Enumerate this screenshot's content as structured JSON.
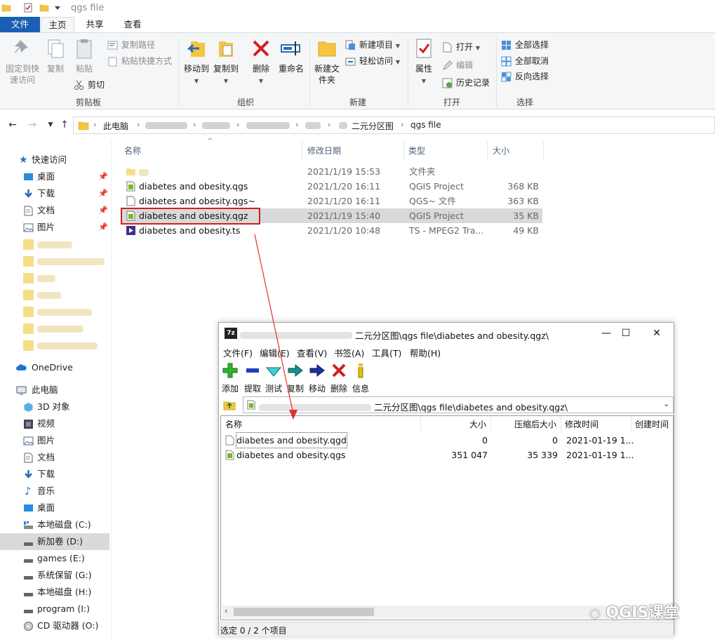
{
  "window": {
    "title": "qgs file"
  },
  "ribbon_tabs": [
    "文件",
    "主页",
    "共享",
    "查看"
  ],
  "ribbon": {
    "clipboard": {
      "label": "剪贴板",
      "pin_quick_access": "固定到快速访问",
      "copy": "复制",
      "paste": "粘贴",
      "copy_path": "复制路径",
      "paste_shortcut": "粘贴快捷方式",
      "cut": "剪切"
    },
    "organize": {
      "label": "组织",
      "move_to": "移动到",
      "copy_to": "复制到",
      "delete": "删除",
      "rename": "重命名"
    },
    "new": {
      "label": "新建",
      "new_folder": "新建文件夹",
      "new_item": "新建项目",
      "easy_access": "轻松访问"
    },
    "open": {
      "label": "打开",
      "properties": "属性",
      "open": "打开",
      "edit": "编辑",
      "history": "历史记录"
    },
    "select": {
      "label": "选择",
      "select_all": "全部选择",
      "select_none": "全部取消",
      "invert": "反向选择"
    }
  },
  "address": {
    "this_pc": "此电脑",
    "folder": "二元分区图",
    "current": "qgs file"
  },
  "nav": {
    "quick_access": "快速访问",
    "desktop": "桌面",
    "downloads": "下载",
    "documents": "文档",
    "pictures": "图片",
    "onedrive": "OneDrive",
    "this_pc": "此电脑",
    "objects3d": "3D 对象",
    "videos": "视频",
    "pictures2": "图片",
    "documents2": "文档",
    "downloads2": "下载",
    "music": "音乐",
    "desktop2": "桌面",
    "drive_c": "本地磁盘 (C:)",
    "drive_d": "新加卷 (D:)",
    "drive_e": "games (E:)",
    "drive_g": "系统保留 (G:)",
    "drive_h": "本地磁盘 (H:)",
    "drive_i": "program (I:)",
    "drive_o": "CD 驱动器 (O:)"
  },
  "filelist": {
    "headers": {
      "name": "名称",
      "modified": "修改日期",
      "type": "类型",
      "size": "大小"
    },
    "rows": [
      {
        "name": "",
        "modified": "2021/1/19 15:53",
        "type": "文件夹",
        "size": ""
      },
      {
        "name": "diabetes and obesity.qgs",
        "modified": "2021/1/20 16:11",
        "type": "QGIS Project",
        "size": "368 KB"
      },
      {
        "name": "diabetes and obesity.qgs~",
        "modified": "2021/1/20 16:11",
        "type": "QGS~ 文件",
        "size": "363 KB"
      },
      {
        "name": "diabetes and obesity.qgz",
        "modified": "2021/1/19 15:40",
        "type": "QGIS Project",
        "size": "35 KB"
      },
      {
        "name": "diabetes and obesity.ts",
        "modified": "2021/1/20 10:48",
        "type": "TS - MPEG2 Tra...",
        "size": "49 KB"
      }
    ]
  },
  "zip": {
    "title": "二元分区图\\qgs file\\diabetes and obesity.qgz\\",
    "menu": [
      "文件(F)",
      "编辑(E)",
      "查看(V)",
      "书签(A)",
      "工具(T)",
      "帮助(H)"
    ],
    "toolbar": [
      "添加",
      "提取",
      "测试",
      "复制",
      "移动",
      "删除",
      "信息"
    ],
    "path": "二元分区图\\qgs file\\diabetes and obesity.qgz\\",
    "headers": {
      "name": "名称",
      "size": "大小",
      "packed": "压缩后大小",
      "modified": "修改时间",
      "created": "创建时间"
    },
    "rows": [
      {
        "name": "diabetes and obesity.qgd",
        "size": "0",
        "packed": "0",
        "modified": "2021-01-19 1..."
      },
      {
        "name": "diabetes and obesity.qgs",
        "size": "351 047",
        "packed": "35 339",
        "modified": "2021-01-19 1..."
      }
    ],
    "status": "选定 0 / 2 个项目"
  },
  "watermark": "QGIS课堂",
  "colors": {
    "accent": "#1a5fb4",
    "highlight": "#d02020",
    "folder": "#f5c542"
  }
}
